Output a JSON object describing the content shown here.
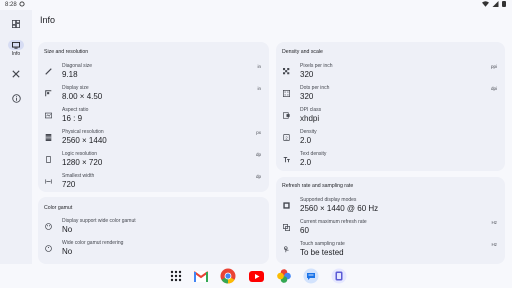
{
  "status": {
    "time": "8:28"
  },
  "rail": {
    "items": [
      {
        "label": ""
      },
      {
        "label": "Info"
      },
      {
        "label": ""
      },
      {
        "label": ""
      }
    ]
  },
  "page": {
    "title": "Info"
  },
  "size_card": {
    "title": "Size and resolution",
    "rows": [
      {
        "label": "Diagonal size",
        "value": "9.18",
        "unit": "in",
        "icon": "ruler-diagonal-icon"
      },
      {
        "label": "Display size",
        "value": "8.00 × 4.50",
        "unit": "in",
        "icon": "display-size-icon"
      },
      {
        "label": "Aspect ratio",
        "value": "16 : 9",
        "unit": "",
        "icon": "aspect-ratio-icon"
      },
      {
        "label": "Physical resolution",
        "value": "2560 × 1440",
        "unit": "px",
        "icon": "grid-icon"
      },
      {
        "label": "Logic resolution",
        "value": "1280 × 720",
        "unit": "dp",
        "icon": "phone-icon"
      },
      {
        "label": "Smallest width",
        "value": "720",
        "unit": "dp",
        "icon": "width-icon"
      }
    ]
  },
  "density_card": {
    "title": "Density and scale",
    "rows": [
      {
        "label": "Pixels per inch",
        "value": "320",
        "unit": "ppi",
        "icon": "pixels-icon"
      },
      {
        "label": "Dots per inch",
        "value": "320",
        "unit": "dpi",
        "icon": "dots-icon"
      },
      {
        "label": "DPI class",
        "value": "xhdpi",
        "unit": "",
        "icon": "dpi-class-icon"
      },
      {
        "label": "Density",
        "value": "2.0",
        "unit": "",
        "icon": "density-icon"
      },
      {
        "label": "Text density",
        "value": "2.0",
        "unit": "",
        "icon": "text-size-icon"
      }
    ]
  },
  "color_card": {
    "title": "Color gamut",
    "rows": [
      {
        "label": "Display support wide color gamut",
        "value": "No",
        "icon": "palette-icon"
      },
      {
        "label": "Wide color gamut rendering",
        "value": "No",
        "icon": "palette-outline-icon"
      }
    ]
  },
  "refresh_card": {
    "title": "Refresh rate and sampling rate",
    "rows": [
      {
        "label": "Supported display modes",
        "value": "2560 × 1440 @ 60 Hz",
        "unit": "",
        "icon": "display-modes-icon"
      },
      {
        "label": "Current maximum refresh rate",
        "value": "60",
        "unit": "Hz",
        "icon": "refresh-icon"
      },
      {
        "label": "Touch sampling rate",
        "value": "To be tested",
        "unit": "Hz",
        "icon": "touch-icon"
      }
    ]
  },
  "dock": {
    "apps": [
      "app-drawer-icon",
      "gmail-icon",
      "chrome-icon",
      "youtube-icon",
      "photos-icon",
      "messages-icon",
      "app-icon"
    ]
  }
}
